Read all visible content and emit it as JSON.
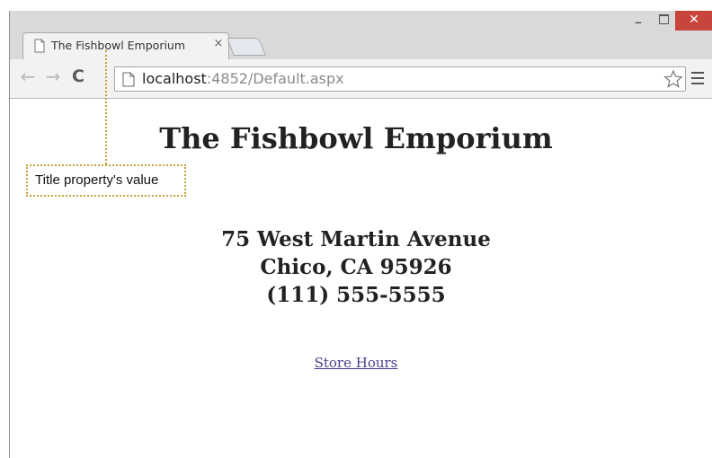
{
  "browser": {
    "tab_title": "The Fishbowl Emporium",
    "tab_close": "×",
    "window_min": "_",
    "window_close": "✕",
    "url_host": "localhost",
    "url_rest": ":4852/Default.aspx",
    "back_icon": "←",
    "forward_icon": "→",
    "reload_icon": "C",
    "accent_close": "#c7453c"
  },
  "page": {
    "heading": "The Fishbowl Emporium",
    "address_line1": "75 West Martin Avenue",
    "address_line2": "Chico, CA 95926",
    "address_line3": "(111) 555-5555",
    "link_label": "Store Hours",
    "link_color": "#4b3c8c"
  },
  "callout": {
    "label": "Title property's value",
    "border_color": "#c5a23a"
  }
}
